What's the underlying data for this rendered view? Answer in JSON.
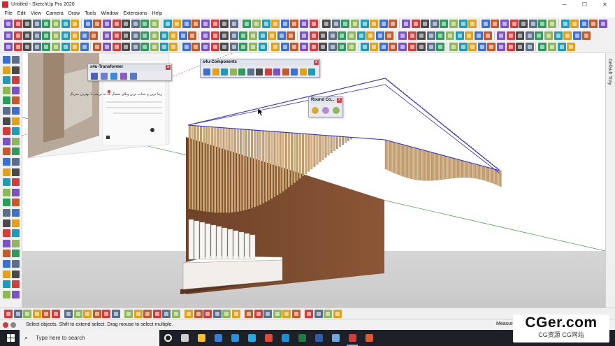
{
  "window": {
    "title": "Untitled - SketchUp Pro 2020",
    "controls": {
      "minimize": "─",
      "maximize": "☐",
      "close": "✕"
    }
  },
  "menubar": {
    "items": [
      "File",
      "Edit",
      "View",
      "Camera",
      "Draw",
      "Tools",
      "Window",
      "Extensions",
      "Help"
    ]
  },
  "tray": {
    "label": "Default Tray"
  },
  "floating": {
    "transformer": {
      "title": "s4u-Transformer",
      "close": "x"
    },
    "components": {
      "title": "s4u-Components",
      "close": "x"
    },
    "roundcorner": {
      "title": "Round Co...",
      "close": "x"
    }
  },
  "reference_image": {
    "caption": "زیبا ترین و جذاب ترین ویلای شمال که به ترتیب با بهترین متریال"
  },
  "statusbar": {
    "hint": "Select objects. Shift to extend select. Drag mouse to select multiple.",
    "measurements_label": "Measurements"
  },
  "taskbar": {
    "search_placeholder": "Type here to search",
    "search_icon": "magnifier-icon",
    "apps": [
      "cortana-icon",
      "task-view-icon",
      "file-explorer-icon",
      "store-icon",
      "mail-icon",
      "telegram-icon",
      "chrome-icon",
      "edge-icon",
      "excel-icon",
      "photoshop-icon",
      "media-icon",
      "sketchup-icon",
      "layout-icon"
    ]
  },
  "watermark": {
    "brand": "CGer.com",
    "subtitle": "CG资源 CG网站"
  },
  "colors": {
    "wood_light": "#d9b98a",
    "wood_dark": "#7a4a2e",
    "outline_blue": "#2f2fd0",
    "ground": "#cfcfcf",
    "accent_red": "#d13d3d"
  }
}
